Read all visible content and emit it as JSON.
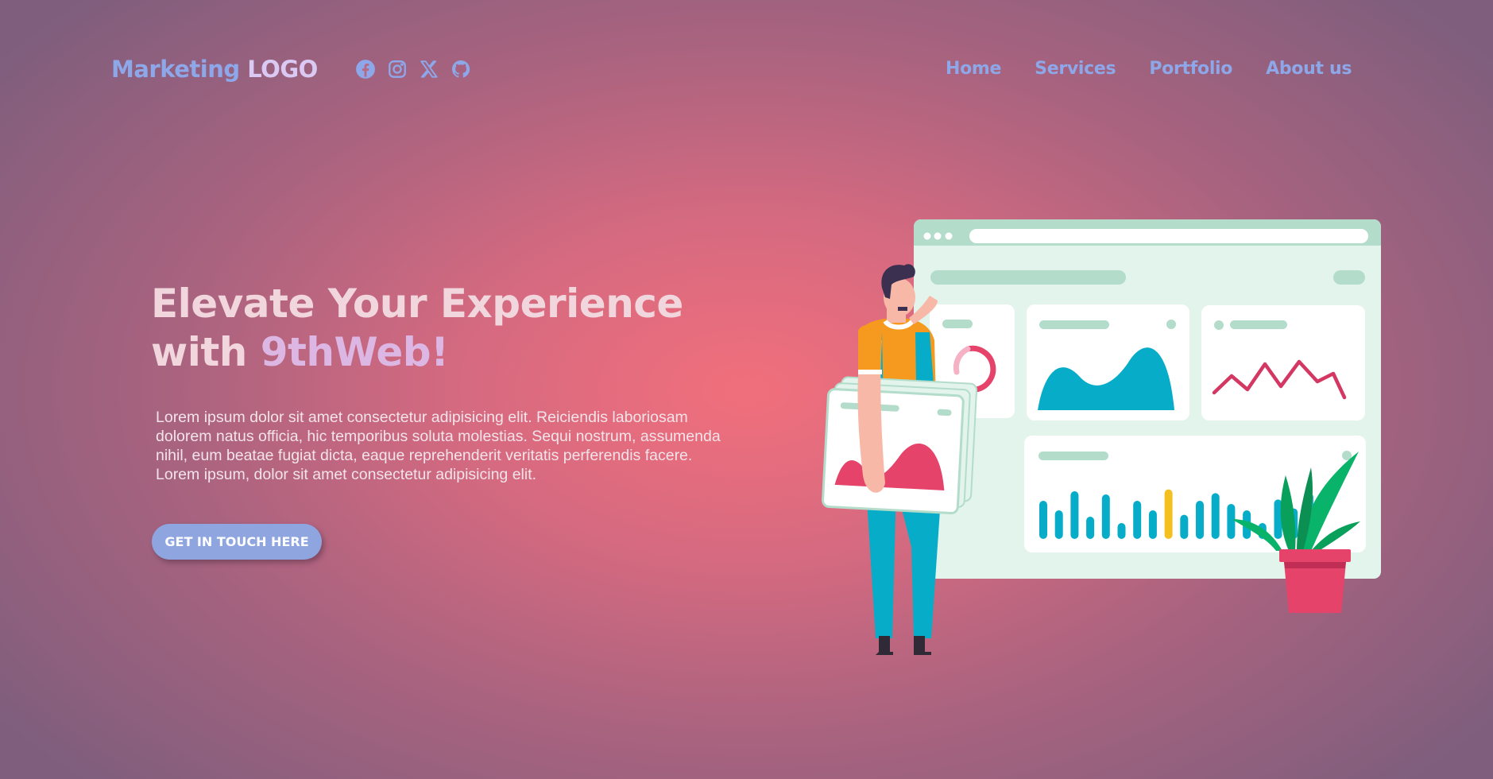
{
  "header": {
    "logo_primary": "Marketing",
    "logo_secondary": "LOGO",
    "social_icons": [
      "facebook-icon",
      "instagram-icon",
      "x-icon",
      "github-icon"
    ],
    "nav": [
      {
        "label": "Home"
      },
      {
        "label": "Services"
      },
      {
        "label": "Portfolio"
      },
      {
        "label": "About us"
      }
    ]
  },
  "hero": {
    "title_line1": "Elevate Your Experience",
    "title_with": "with ",
    "title_highlight": "9thWeb!",
    "body": "Lorem ipsum dolor sit amet consectetur adipisicing elit. Reiciendis laboriosam dolorem natus officia, hic temporibus soluta molestias. Sequi nostrum, assumenda nihil, eum beatae fugiat dicta, eaque reprehenderit veritatis perferendis facere. Lorem ipsum, dolor sit amet consectetur adipisicing elit.",
    "cta_label": "GET IN TOUCH HERE"
  },
  "illustration": {
    "icon": "analytics-dashboard-illustration",
    "bar_levels": [
      0.6,
      0.45,
      0.75,
      0.35,
      0.7,
      0.25,
      0.6,
      0.45,
      0.78,
      0.38,
      0.6,
      0.72,
      0.55,
      0.45,
      0.25,
      0.62,
      0.48,
      0.72
    ],
    "accent_bar_index": 8
  },
  "colors": {
    "accent_blue": "#8da7e8",
    "logo_light": "#d9c9f3",
    "title_highlight": "#dcb7e4",
    "teal": "#07adc8",
    "pink": "#e5436a",
    "mint": "#b3dccb"
  }
}
